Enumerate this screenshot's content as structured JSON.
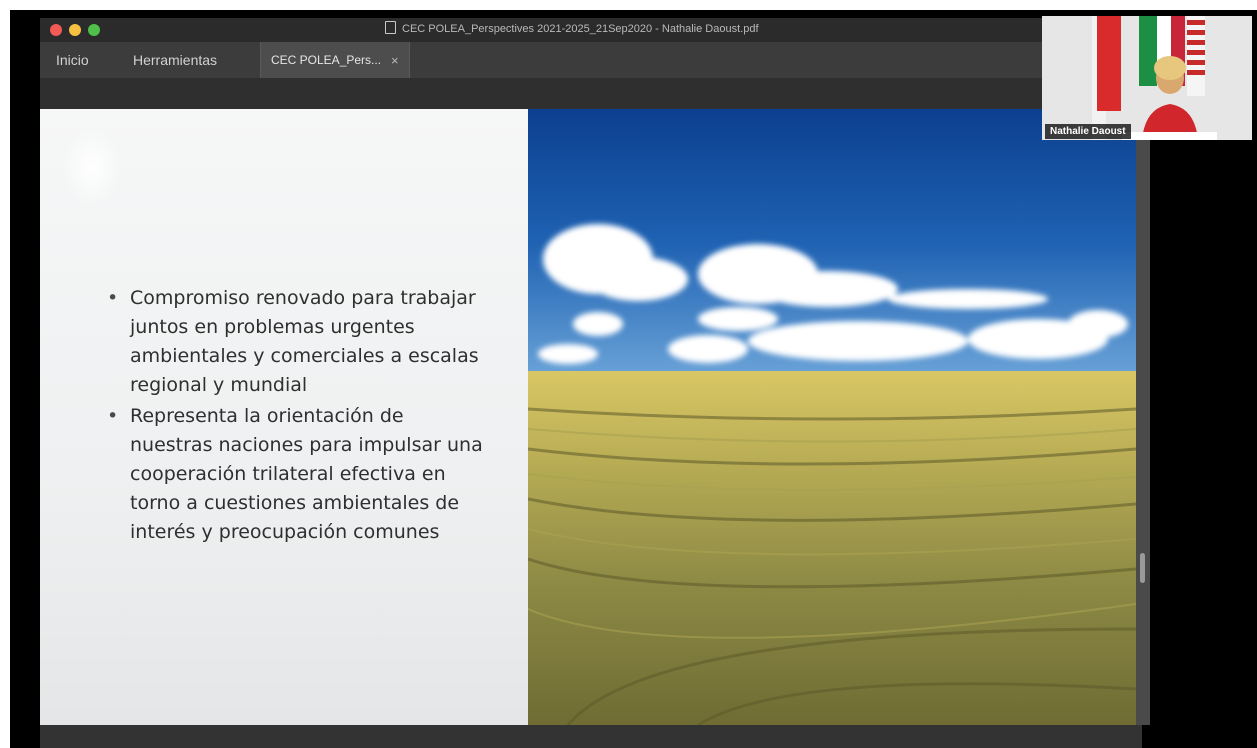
{
  "window": {
    "title": "CEC POLEA_Perspectives 2021-2025_21Sep2020 - Nathalie Daoust.pdf",
    "traffic_lights": [
      "#f25a55",
      "#f6c143",
      "#4fc14a"
    ]
  },
  "tabs": {
    "home": "Inicio",
    "tools": "Herramientas",
    "document": "CEC POLEA_Pers...",
    "close": "×"
  },
  "slide": {
    "bullets": [
      "Compromiso renovado para trabajar juntos en problemas urgentes ambientales y comerciales a escalas regional y mundial",
      "Representa la orientación de nuestras naciones para impulsar una cooperación trilateral efectiva en torno a cuestiones ambientales de interés y preocupación comunes"
    ],
    "image_description": "wheat-field-under-blue-sky"
  },
  "video": {
    "participant_name": "Nathalie Daoust"
  }
}
